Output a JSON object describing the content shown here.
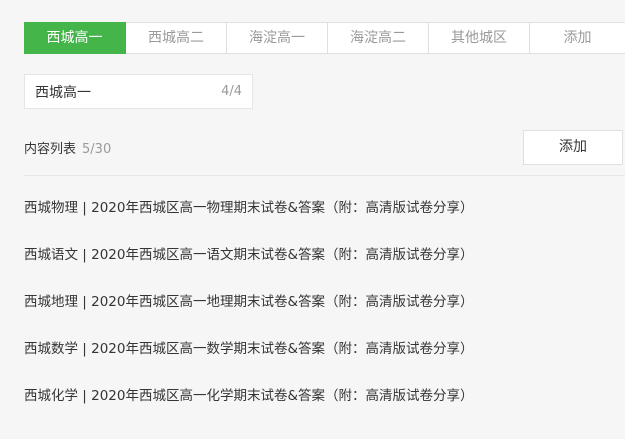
{
  "tabs": [
    {
      "label": "西城高一",
      "active": true
    },
    {
      "label": "西城高二",
      "active": false
    },
    {
      "label": "海淀高一",
      "active": false
    },
    {
      "label": "海淀高二",
      "active": false
    },
    {
      "label": "其他城区",
      "active": false
    },
    {
      "label": "添加",
      "active": false
    }
  ],
  "name_input": {
    "value": "西城高一",
    "counter": "4/4"
  },
  "list": {
    "title": "内容列表",
    "count": "5/30",
    "add_label": "添加",
    "items": [
      "西城物理 | 2020年西城区高一物理期末试卷&答案（附：高清版试卷分享）",
      "西城语文 | 2020年西城区高一语文期末试卷&答案（附：高清版试卷分享）",
      "西城地理 | 2020年西城区高一地理期末试卷&答案（附：高清版试卷分享）",
      "西城数学 | 2020年西城区高一数学期末试卷&答案（附：高清版试卷分享）",
      "西城化学 | 2020年西城区高一化学期末试卷&答案（附：高清版试卷分享）"
    ]
  },
  "colors": {
    "accent": "#44b549",
    "muted": "#9a9a9a",
    "text": "#353535"
  }
}
